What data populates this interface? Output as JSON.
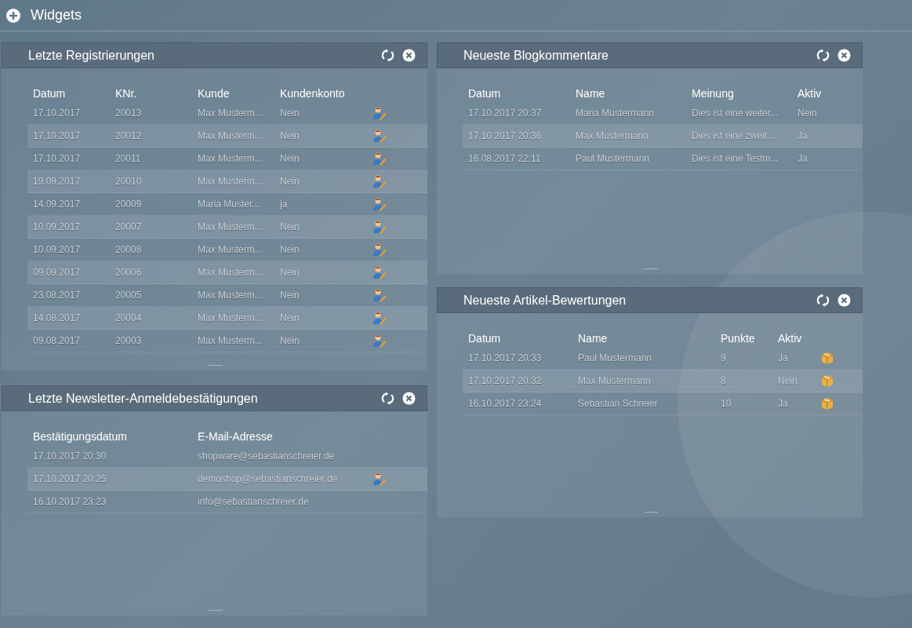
{
  "header": {
    "title": "Widgets"
  },
  "widgets": [
    {
      "kind": "registrations",
      "title": "Letzte Registrierungen",
      "columns": [
        "Datum",
        "KNr.",
        "Kunde",
        "Kundenkonto"
      ],
      "rows": [
        {
          "cells": [
            "17.10.2017",
            "20013",
            "Max Musterm...",
            "Nein"
          ]
        },
        {
          "cells": [
            "17.10.2017",
            "20012",
            "Max Musterm...",
            "Nein"
          ]
        },
        {
          "cells": [
            "17.10.2017",
            "20011",
            "Max Musterm...",
            "Nein"
          ]
        },
        {
          "cells": [
            "19.09.2017",
            "20010",
            "Max Musterm...",
            "Nein"
          ]
        },
        {
          "cells": [
            "14.09.2017",
            "20009",
            "Maria Muster...",
            "ja"
          ]
        },
        {
          "cells": [
            "10.09.2017",
            "20007",
            "Max Musterm...",
            "Nein"
          ]
        },
        {
          "cells": [
            "10.09.2017",
            "20008",
            "Max Musterm...",
            "Nein"
          ]
        },
        {
          "cells": [
            "09.09.2017",
            "20006",
            "Max Musterm...",
            "Nein"
          ]
        },
        {
          "cells": [
            "23.08.2017",
            "20005",
            "Max Musterm...",
            "Nein"
          ]
        },
        {
          "cells": [
            "14.08.2017",
            "20004",
            "Max Musterm...",
            "Nein"
          ]
        },
        {
          "cells": [
            "09.08.2017",
            "20003",
            "Max Musterm...",
            "Nein"
          ]
        }
      ]
    },
    {
      "kind": "newsletter",
      "title": "Letzte Newsletter-Anmeldebestätigungen",
      "columns": [
        "Bestätigungsdatum",
        "E-Mail-Adresse"
      ],
      "rows": [
        {
          "cells": [
            "17.10.2017 20:30",
            "shopware@sebastianschreier.de"
          ],
          "hovered": false
        },
        {
          "cells": [
            "17.10.2017 20:25",
            "demoshop@sebastianschreier.de"
          ],
          "hovered": true
        },
        {
          "cells": [
            "16.10.2017 23:23",
            "info@sebastianschreier.de"
          ],
          "hovered": false
        }
      ]
    },
    {
      "kind": "blog",
      "title": "Neueste Blogkommentare",
      "columns": [
        "Datum",
        "Name",
        "Meinung",
        "Aktiv"
      ],
      "rows": [
        {
          "cells": [
            "17.10.2017 20:37",
            "Maria Mustermann",
            "Dies ist eine weiter...",
            "Nein"
          ]
        },
        {
          "cells": [
            "17.10.2017 20:36",
            "Max Mustermann",
            "Dies ist eine zweit...",
            "Ja"
          ]
        },
        {
          "cells": [
            "16.08.2017 22:11",
            "Paul Mustermann",
            "Dies ist eine Testm...",
            "Ja"
          ]
        }
      ]
    },
    {
      "kind": "reviews",
      "title": "Neueste Artikel-Bewertungen",
      "columns": [
        "Datum",
        "Name",
        "Punkte",
        "Aktiv"
      ],
      "rows": [
        {
          "cells": [
            "17.10.2017 20:33",
            "Paul Mustermann",
            "9",
            "Ja"
          ]
        },
        {
          "cells": [
            "17.10.2017 20:32",
            "Max Mustermann",
            "8",
            "Nein"
          ]
        },
        {
          "cells": [
            "16.10.2017 23:24",
            "Sebastian Schreier",
            "10",
            "Ja"
          ]
        }
      ]
    }
  ]
}
